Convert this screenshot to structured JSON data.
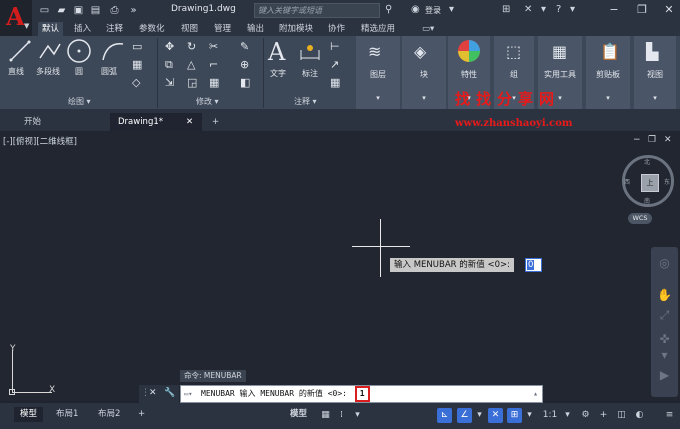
{
  "titlebar": {
    "doc_title": "Drawing1.dwg",
    "search_placeholder": "键入关键字或短语",
    "login": "登录"
  },
  "ribbon_tabs": [
    "默认",
    "插入",
    "注释",
    "参数化",
    "视图",
    "管理",
    "输出",
    "附加模块",
    "协作",
    "精选应用"
  ],
  "ribbon": {
    "draw": {
      "line": "直线",
      "polyline": "多段线",
      "circle": "圆",
      "arc": "圆弧",
      "panel": "绘图"
    },
    "modify": {
      "panel": "修改"
    },
    "annotation": {
      "text": "文字",
      "dimension": "标注",
      "panel": "注释"
    },
    "big": [
      "图层",
      "块",
      "特性",
      "组",
      "实用工具",
      "剪贴板",
      "视图"
    ]
  },
  "doc_tabs": {
    "start": "开始",
    "drawing": "Drawing1*"
  },
  "watermark": {
    "cn": "找找分享网",
    "url": "www.zhanshaoyi.com"
  },
  "canvas": {
    "view_label": "[-][俯视][二维线框]",
    "dyn_prompt": "输入 MENUBAR 的新值 <0>:",
    "dyn_value": "0",
    "viewcube": {
      "face": "上",
      "north": "北",
      "south": "南",
      "west": "西",
      "east": "东",
      "wcs": "WCS"
    },
    "ucs_y": "Y",
    "ucs_x": "X"
  },
  "command": {
    "history": "命令: MENUBAR",
    "prompt": "MENUBAR 输入 MENUBAR 的新值 <0>:",
    "value": "1"
  },
  "statusbar": {
    "tabs": [
      "模型",
      "布局1",
      "布局2"
    ],
    "model": "模型",
    "scale": "1:1"
  }
}
